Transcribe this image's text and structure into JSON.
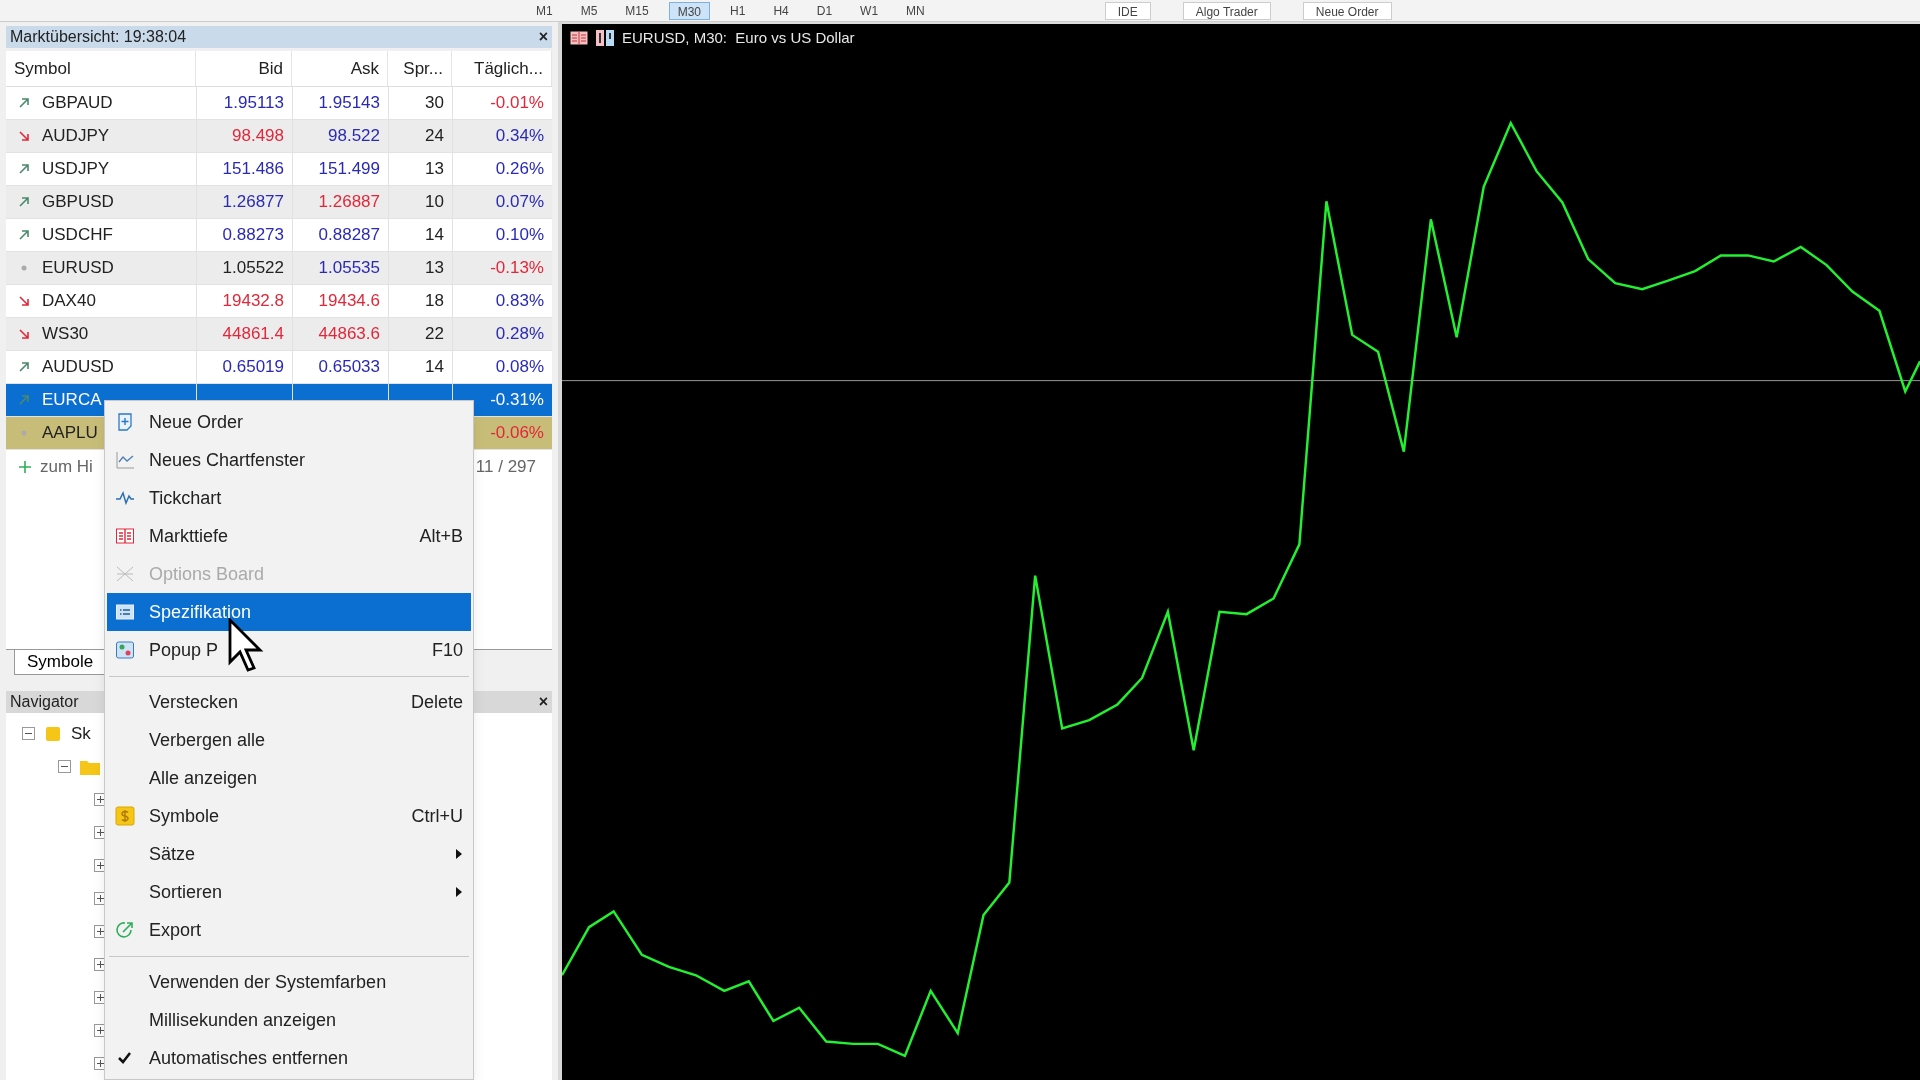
{
  "toolbar": {
    "timeframes": [
      {
        "label": "M1",
        "selected": false
      },
      {
        "label": "M5",
        "selected": false
      },
      {
        "label": "M15",
        "selected": false
      },
      {
        "label": "M30",
        "selected": true
      },
      {
        "label": "H1",
        "selected": false
      },
      {
        "label": "H4",
        "selected": false
      },
      {
        "label": "D1",
        "selected": false
      },
      {
        "label": "W1",
        "selected": false
      },
      {
        "label": "MN",
        "selected": false
      }
    ],
    "buttons": [
      "IDE",
      "Algo Trader",
      "Neue Order"
    ]
  },
  "market_watch": {
    "title": "Marktübersicht: 19:38:04",
    "close": "×",
    "columns": [
      "Symbol",
      "Bid",
      "Ask",
      "Spr...",
      "Täglich..."
    ],
    "rows": [
      {
        "up": true,
        "down": false,
        "symbol": "GBPAUD",
        "bid": {
          "text": "1.95113",
          "color": "#2a2ab4"
        },
        "ask": {
          "text": "1.95143",
          "color": "#2a2ab4"
        },
        "spread": "30",
        "daily": {
          "text": "-0.01%",
          "color": "#e0283a"
        },
        "selected": false
      },
      {
        "up": false,
        "down": true,
        "symbol": "AUDJPY",
        "bid": {
          "text": "98.498",
          "color": "#e0283a"
        },
        "ask": {
          "text": "98.522",
          "color": "#2a2ab4"
        },
        "spread": "24",
        "daily": {
          "text": "0.34%",
          "color": "#2a2ab4"
        },
        "selected": false
      },
      {
        "up": true,
        "down": false,
        "symbol": "USDJPY",
        "bid": {
          "text": "151.486",
          "color": "#2a2ab4"
        },
        "ask": {
          "text": "151.499",
          "color": "#2a2ab4"
        },
        "spread": "13",
        "daily": {
          "text": "0.26%",
          "color": "#2a2ab4"
        },
        "selected": false
      },
      {
        "up": true,
        "down": false,
        "symbol": "GBPUSD",
        "bid": {
          "text": "1.26877",
          "color": "#2a2ab4"
        },
        "ask": {
          "text": "1.26887",
          "color": "#e0283a"
        },
        "spread": "10",
        "daily": {
          "text": "0.07%",
          "color": "#2a2ab4"
        },
        "selected": false
      },
      {
        "up": true,
        "down": false,
        "symbol": "USDCHF",
        "bid": {
          "text": "0.88273",
          "color": "#2a2ab4"
        },
        "ask": {
          "text": "0.88287",
          "color": "#2a2ab4"
        },
        "spread": "14",
        "daily": {
          "text": "0.10%",
          "color": "#2a2ab4"
        },
        "selected": false
      },
      {
        "up": false,
        "down": false,
        "symbol": "EURUSD",
        "bid": {
          "text": "1.05522",
          "color": "#222222"
        },
        "ask": {
          "text": "1.05535",
          "color": "#2a2ab4"
        },
        "spread": "13",
        "daily": {
          "text": "-0.13%",
          "color": "#e0283a"
        },
        "selected": false
      },
      {
        "up": false,
        "down": true,
        "symbol": "DAX40",
        "bid": {
          "text": "19432.8",
          "color": "#e0283a"
        },
        "ask": {
          "text": "19434.6",
          "color": "#e0283a"
        },
        "spread": "18",
        "daily": {
          "text": "0.83%",
          "color": "#2a2ab4"
        },
        "selected": false
      },
      {
        "up": false,
        "down": true,
        "symbol": "WS30",
        "bid": {
          "text": "44861.4",
          "color": "#e0283a"
        },
        "ask": {
          "text": "44863.6",
          "color": "#e0283a"
        },
        "spread": "22",
        "daily": {
          "text": "0.28%",
          "color": "#2a2ab4"
        },
        "selected": false
      },
      {
        "up": true,
        "down": false,
        "symbol": "AUDUSD",
        "bid": {
          "text": "0.65019",
          "color": "#2a2ab4"
        },
        "ask": {
          "text": "0.65033",
          "color": "#2a2ab4"
        },
        "spread": "14",
        "daily": {
          "text": "0.08%",
          "color": "#2a2ab4"
        },
        "selected": false
      },
      {
        "up": true,
        "down": false,
        "symbol": "EURCA",
        "daily": {
          "text": "-0.31%",
          "color": "#ffffff"
        },
        "selected": true
      },
      {
        "up": false,
        "down": false,
        "symbol": "AAPLU",
        "daily": {
          "text": "-0.06%",
          "color": "#e0283a"
        },
        "selected": false,
        "color": "#c8bd78"
      }
    ],
    "add_row": {
      "label": "zum Hi",
      "count": "11 / 297"
    },
    "tabs": [
      {
        "label": "Symbole",
        "selected": true
      }
    ]
  },
  "navigator": {
    "title": "Navigator",
    "close": "×",
    "tree": [
      {
        "label": "Sk",
        "expanded": true,
        "children": [
          {
            "expanded": true,
            "children": [
              {
                "expanded": false
              },
              {
                "expanded": false
              },
              {
                "expanded": false
              },
              {
                "expanded": false
              },
              {
                "expanded": false
              },
              {
                "expanded": false
              },
              {
                "expanded": false
              },
              {
                "expanded": false
              },
              {
                "expanded": false
              }
            ]
          }
        ]
      }
    ]
  },
  "chart": {
    "title": "EURUSD, M30:  Euro vs US Dollar"
  },
  "context_menu": {
    "items": [
      {
        "kind": "item",
        "label": "Neue Order",
        "disabled": false,
        "selected": false,
        "checked": false
      },
      {
        "kind": "item",
        "label": "Neues Chartfenster",
        "disabled": false,
        "selected": false,
        "checked": false
      },
      {
        "kind": "item",
        "label": "Tickchart",
        "disabled": false,
        "selected": false,
        "checked": false
      },
      {
        "kind": "item",
        "label": "Markttiefe",
        "shortcut": "Alt+B",
        "disabled": false,
        "selected": false,
        "checked": false
      },
      {
        "kind": "item",
        "label": "Options Board",
        "disabled": true,
        "selected": false,
        "checked": false
      },
      {
        "kind": "item",
        "label": "Spezifikation",
        "disabled": false,
        "selected": true,
        "checked": false
      },
      {
        "kind": "item",
        "label": "Popup P",
        "shortcut": "F10",
        "disabled": false,
        "selected": false,
        "checked": false
      },
      {
        "kind": "separator"
      },
      {
        "kind": "item",
        "label": "Verstecken",
        "shortcut": "Delete",
        "disabled": false,
        "selected": false,
        "checked": false
      },
      {
        "kind": "item",
        "label": "Verbergen alle",
        "disabled": false,
        "selected": false,
        "checked": false
      },
      {
        "kind": "item",
        "label": "Alle anzeigen",
        "disabled": false,
        "selected": false,
        "checked": false
      },
      {
        "kind": "item",
        "label": "Symbole",
        "shortcut": "Ctrl+U",
        "disabled": false,
        "selected": false,
        "checked": false
      },
      {
        "kind": "submenu",
        "label": "Sätze",
        "disabled": false,
        "selected": false,
        "checked": false
      },
      {
        "kind": "submenu",
        "label": "Sortieren",
        "disabled": false,
        "selected": false,
        "checked": false
      },
      {
        "kind": "item",
        "label": "Export",
        "disabled": false,
        "selected": false,
        "checked": false
      },
      {
        "kind": "separator"
      },
      {
        "kind": "item",
        "label": "Verwenden der Systemfarben",
        "disabled": false,
        "selected": false,
        "checked": false
      },
      {
        "kind": "item",
        "label": "Millisekunden anzeigen",
        "disabled": false,
        "selected": false,
        "checked": false
      },
      {
        "kind": "item",
        "label": "Automatisches entfernen",
        "disabled": false,
        "selected": false,
        "checked": true
      }
    ]
  }
}
